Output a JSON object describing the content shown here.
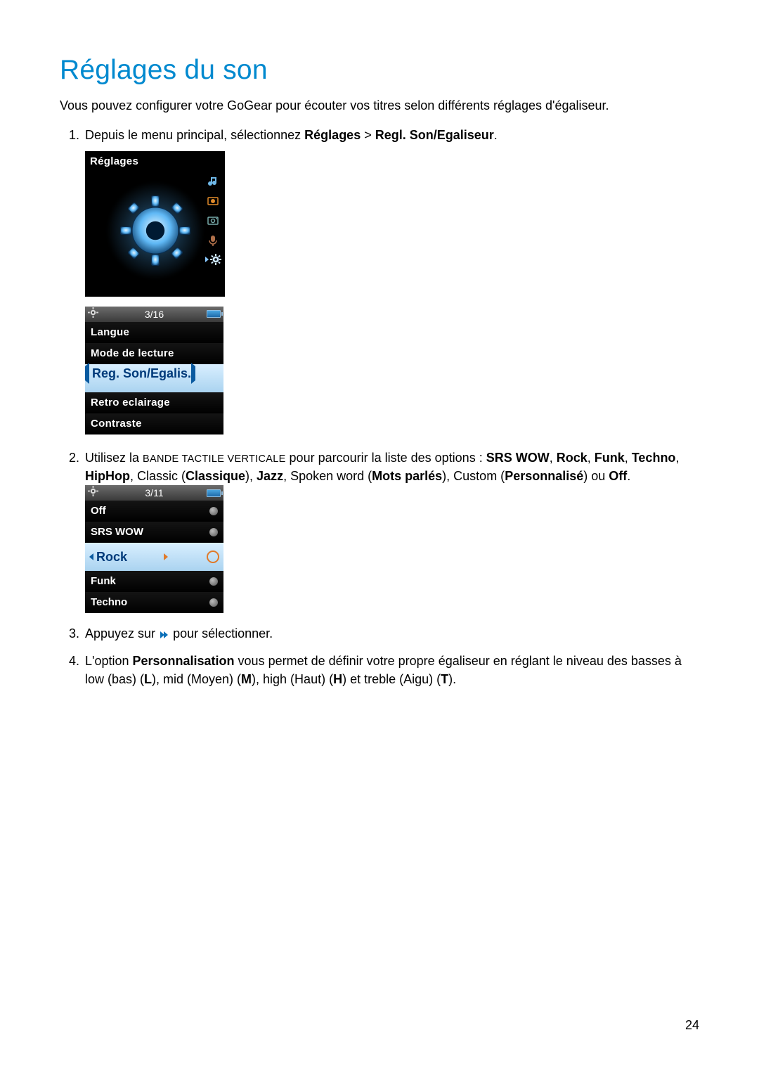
{
  "page_number": "24",
  "title": "Réglages du son",
  "intro": "Vous pouvez configurer votre GoGear pour écouter vos titres selon différents réglages d'égaliseur.",
  "steps": {
    "s1_pre": "Depuis le menu principal, sélectionnez ",
    "s1_b1": "Réglages",
    "s1_gt": " > ",
    "s1_b2": "Regl. Son/Egaliseur",
    "s1_post": ".",
    "s2_pre": "Utilisez la ",
    "s2_caps": "bande tactile verticale",
    "s2_mid": " pour parcourir la liste des options : ",
    "s2_b_srs": "SRS WOW",
    "s2_c1": ", ",
    "s2_b_rock": "Rock",
    "s2_c2": ", ",
    "s2_b_funk": "Funk",
    "s2_c3": ", ",
    "s2_b_techno": "Techno",
    "s2_c4": ", ",
    "s2_b_hiphop": "HipHop",
    "s2_c5": ", Classic (",
    "s2_b_classic": "Classique",
    "s2_c6": "), ",
    "s2_b_jazz": "Jazz",
    "s2_c7": ", Spoken word (",
    "s2_b_spoken": "Mots parlés",
    "s2_c8": "), Custom (",
    "s2_b_custom": "Personnalisé",
    "s2_c9": ") ou ",
    "s2_b_off": "Off",
    "s2_c10": ".",
    "s3_pre": "Appuyez sur ",
    "s3_post": " pour sélectionner.",
    "s4_pre": "L'option ",
    "s4_b1": "Personnalisation",
    "s4_mid": " vous permet de définir votre propre égaliseur en réglant le niveau des basses à low (bas) (",
    "s4_bL": "L",
    "s4_m2": "), mid (Moyen) (",
    "s4_bM": "M",
    "s4_m3": "), high (Haut) (",
    "s4_bH": "H",
    "s4_m4": ") et treble (Aigu) (",
    "s4_bT": "T",
    "s4_m5": ")."
  },
  "device1": {
    "title": "Réglages"
  },
  "device2": {
    "pos": "3/16",
    "items": [
      "Langue",
      "Mode de lecture",
      "Reg. Son/Egalis.",
      "Retro eclairage",
      "Contraste"
    ]
  },
  "device3": {
    "pos": "3/11",
    "items": [
      "Off",
      "SRS WOW",
      "Rock",
      "Funk",
      "Techno"
    ]
  }
}
